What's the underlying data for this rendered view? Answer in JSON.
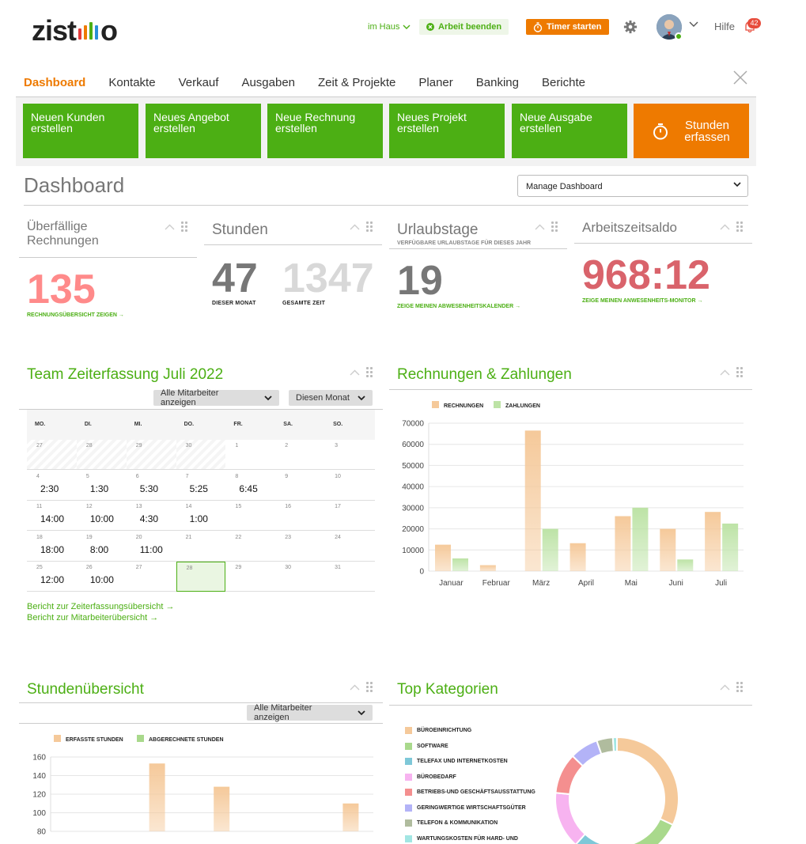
{
  "header": {
    "logo_text_left": "zist",
    "logo_text_right": "o",
    "logo_letters": "zistemo",
    "location_label": "im Haus",
    "end_work_label": "Arbeit beenden",
    "timer_label": "Timer starten",
    "help_label": "Hilfe",
    "notification_count": "42",
    "colors": {
      "green": "#4caf14",
      "orange": "#ee7a00",
      "badge": "#e74c3c"
    }
  },
  "nav": {
    "items": [
      {
        "label": "Dashboard",
        "active": true
      },
      {
        "label": "Kontakte"
      },
      {
        "label": "Verkauf"
      },
      {
        "label": "Ausgaben"
      },
      {
        "label": "Zeit & Projekte"
      },
      {
        "label": "Planer"
      },
      {
        "label": "Banking"
      },
      {
        "label": "Berichte"
      }
    ]
  },
  "quick_actions": {
    "new_customer_l1": "Neuen Kunden",
    "new_customer_l2": "erstellen",
    "new_offer_l1": "Neues Angebot",
    "new_offer_l2": "erstellen",
    "new_invoice_l1": "Neue Rechnung",
    "new_invoice_l2": "erstellen",
    "new_project_l1": "Neues Projekt",
    "new_project_l2": "erstellen",
    "new_expense_l1": "Neue Ausgabe",
    "new_expense_l2": "erstellen",
    "log_hours_l1": "Stunden",
    "log_hours_l2": "erfassen"
  },
  "dashboard": {
    "title": "Dashboard",
    "manage_label": "Manage Dashboard"
  },
  "widgets": {
    "overdue": {
      "title_l1": "Überfällige",
      "title_l2": "Rechnungen",
      "value": "135",
      "link": "RECHNUNGSÜBERSICHT ZEIGEN",
      "color": "#ff8a8a"
    },
    "hours": {
      "title": "Stunden",
      "month_value": "47",
      "month_label": "DIESER MONAT",
      "total_value": "1347",
      "total_label": "GESAMTE ZEIT"
    },
    "vacation": {
      "title": "Urlaubstage",
      "subtitle": "VERFÜGBARE URLAUBSTAGE FÜR DIESES JAHR",
      "value": "19",
      "link": "ZEIGE MEINEN ABWESENHEITSKALENDER"
    },
    "worktime": {
      "title": "Arbeitszeitsaldo",
      "value": "968:12",
      "link": "ZEIGE MEINEN ANWESENHEITS-MONITOR",
      "color": "#d9636b"
    }
  },
  "team_time": {
    "title": "Team Zeiterfassung Juli 2022",
    "employee_filter": "Alle Mitarbeiter anzeigen",
    "period_filter": "Diesen Monat",
    "weekdays": [
      "MO.",
      "DI.",
      "MI.",
      "DO.",
      "FR.",
      "SA.",
      "SO."
    ],
    "weeks": [
      [
        {
          "d": "27",
          "h": ""
        },
        {
          "d": "28",
          "h": ""
        },
        {
          "d": "29",
          "h": ""
        },
        {
          "d": "30",
          "h": ""
        },
        {
          "d": "1",
          "h": ""
        },
        {
          "d": "2",
          "h": ""
        },
        {
          "d": "3",
          "h": ""
        }
      ],
      [
        {
          "d": "4",
          "h": "2:30"
        },
        {
          "d": "5",
          "h": "1:30"
        },
        {
          "d": "6",
          "h": "5:30"
        },
        {
          "d": "7",
          "h": "5:25"
        },
        {
          "d": "8",
          "h": "6:45"
        },
        {
          "d": "9",
          "h": ""
        },
        {
          "d": "10",
          "h": ""
        }
      ],
      [
        {
          "d": "11",
          "h": "14:00"
        },
        {
          "d": "12",
          "h": "10:00"
        },
        {
          "d": "13",
          "h": "4:30"
        },
        {
          "d": "14",
          "h": "1:00"
        },
        {
          "d": "15",
          "h": ""
        },
        {
          "d": "16",
          "h": ""
        },
        {
          "d": "17",
          "h": ""
        }
      ],
      [
        {
          "d": "18",
          "h": "18:00"
        },
        {
          "d": "19",
          "h": "8:00"
        },
        {
          "d": "20",
          "h": "11:00"
        },
        {
          "d": "21",
          "h": ""
        },
        {
          "d": "22",
          "h": ""
        },
        {
          "d": "23",
          "h": ""
        },
        {
          "d": "24",
          "h": ""
        }
      ],
      [
        {
          "d": "25",
          "h": "12:00"
        },
        {
          "d": "26",
          "h": "10:00"
        },
        {
          "d": "27",
          "h": ""
        },
        {
          "d": "28",
          "h": "",
          "today": true
        },
        {
          "d": "29",
          "h": ""
        },
        {
          "d": "30",
          "h": ""
        },
        {
          "d": "31",
          "h": ""
        }
      ]
    ],
    "link_time": "Bericht zur Zeiterfassungsübersicht",
    "link_staff": "Bericht zur Mitarbeiterübersicht"
  },
  "invoices_payments": {
    "title": "Rechnungen & Zahlungen"
  },
  "hours_overview": {
    "title": "Stundenübersicht",
    "employee_filter": "Alle Mitarbeiter anzeigen"
  },
  "top_categories": {
    "title": "Top Kategorien"
  },
  "chart_data": [
    {
      "type": "bar",
      "categories": [
        "Januar",
        "Februar",
        "März",
        "April",
        "Mai",
        "Juni",
        "Juli"
      ],
      "series": [
        {
          "name": "RECHNUNGEN",
          "values": [
            12500,
            2800,
            66500,
            13200,
            26000,
            20000,
            28000
          ],
          "color": "#f5c99a"
        },
        {
          "name": "ZAHLUNGEN",
          "values": [
            6000,
            0,
            20000,
            0,
            30000,
            5500,
            22500
          ],
          "color": "#bde3a6"
        }
      ],
      "ylim": [
        0,
        70000
      ],
      "yticks": [
        "0",
        "10000",
        "20000",
        "30000",
        "40000",
        "50000",
        "60000",
        "70000"
      ],
      "grid": true,
      "legend": "top-left"
    },
    {
      "type": "bar",
      "series": [
        {
          "name": "ERFASSTE STUNDEN",
          "values": [
            0,
            153,
            128,
            0,
            110
          ],
          "color": "#f5c99a"
        },
        {
          "name": "ABGERECHNETE STUNDEN",
          "values": [
            0,
            0,
            0,
            0,
            0
          ],
          "color": "#a9d98c"
        }
      ],
      "ylim": [
        80,
        160
      ],
      "yticks": [
        "80",
        "100",
        "120",
        "140",
        "160"
      ],
      "grid": true,
      "legend": "top-left"
    },
    {
      "type": "pie",
      "labels": [
        "BÜROEINRICHTUNG",
        "SOFTWARE",
        "TELEFAX UND INTERNETKOSTEN",
        "BÜROBEDARF",
        "BETRIEBS-UND GESCHÄFTSAUSSTATTUNG",
        "GERINGWERTIGE WIRTSCHAFTSGÜTER",
        "TELEFON & KOMMUNIKATION",
        "WARTUNGSKOSTEN FÜR HARD- UND"
      ],
      "values": [
        30,
        19,
        9,
        14,
        10,
        7,
        4,
        1
      ],
      "colors": [
        "#f5c99a",
        "#a9d98c",
        "#7ec8d8",
        "#f7b3f0",
        "#f48f8f",
        "#b3b3f7",
        "#b0bc9e",
        "#a2e6e3"
      ],
      "legend": "left"
    }
  ]
}
